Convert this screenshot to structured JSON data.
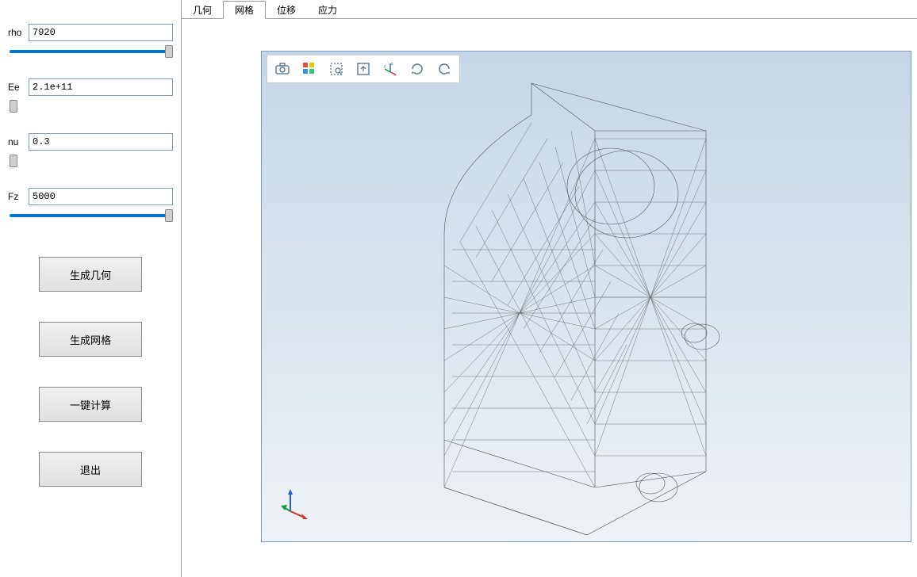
{
  "params": {
    "rho": {
      "label": "rho",
      "value": "7920",
      "slider": 100
    },
    "Ee": {
      "label": "Ee",
      "value": "2.1e+11",
      "slider": 0
    },
    "nu": {
      "label": "nu",
      "value": "0.3",
      "slider": 0
    },
    "Fz": {
      "label": "Fz",
      "value": "5000",
      "slider": 100
    }
  },
  "buttons": {
    "gen_geom": "生成几何",
    "gen_mesh": "生成网格",
    "compute": "一键计算",
    "exit": "退出"
  },
  "tabs": {
    "geom": "几何",
    "mesh": "网格",
    "disp": "位移",
    "stress": "应力",
    "active": "mesh"
  },
  "toolbar_icons": {
    "snapshot": "camera-icon",
    "scene": "scene-icon",
    "zoom_box": "zoom-box-icon",
    "zoom_extents": "zoom-extents-icon",
    "axes": "axes-icon",
    "rotate_ccw": "rotate-ccw-icon",
    "rotate_cw": "rotate-cw-icon"
  }
}
